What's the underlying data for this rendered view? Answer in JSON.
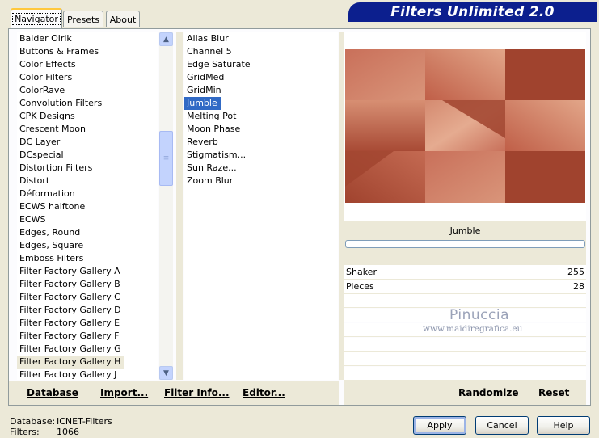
{
  "tabs": [
    {
      "label": "Navigator"
    },
    {
      "label": "Presets"
    },
    {
      "label": "About"
    }
  ],
  "banner": {
    "title": "Filters Unlimited 2.0"
  },
  "categories": [
    "Balder Olrik",
    "Buttons & Frames",
    "Color Effects",
    "Color Filters",
    "ColorRave",
    "Convolution Filters",
    "CPK Designs",
    "Crescent Moon",
    "DC Layer",
    "DCspecial",
    "Distortion Filters",
    "Distort",
    "Déformation",
    "ECWS halftone",
    "ECWS",
    "Edges, Round",
    "Edges, Square",
    "Emboss Filters",
    "Filter Factory Gallery A",
    "Filter Factory Gallery B",
    "Filter Factory Gallery C",
    "Filter Factory Gallery D",
    "Filter Factory Gallery E",
    "Filter Factory Gallery F",
    "Filter Factory Gallery G",
    "Filter Factory Gallery H",
    "Filter Factory Gallery J"
  ],
  "selected_category": "Filter Factory Gallery H",
  "filters": [
    "Alias Blur",
    "Channel 5",
    "Edge Saturate",
    "GridMed",
    "GridMin",
    "Jumble",
    "Melting Pot",
    "Moon Phase",
    "Reverb",
    "Stigmatism...",
    "Sun Raze...",
    "Zoom Blur"
  ],
  "selected_filter": "Jumble",
  "left_buttons": {
    "database": "Database",
    "import": "Import...",
    "filter_info": "Filter Info...",
    "editor": "Editor..."
  },
  "filter_panel": {
    "title": "Jumble",
    "params": [
      {
        "label": "Shaker",
        "value": "255"
      },
      {
        "label": "Pieces",
        "value": "28"
      }
    ],
    "randomize": "Randomize",
    "reset": "Reset"
  },
  "watermark": {
    "line1": "Pinuccia",
    "line2": "www.maidiregrafica.eu"
  },
  "status": {
    "database_label": "Database:",
    "database_value": "ICNET-Filters",
    "filters_label": "Filters:",
    "filters_value": "1066"
  },
  "dialog_buttons": {
    "apply": "Apply",
    "cancel": "Cancel",
    "help": "Help"
  },
  "colors": {
    "banner_bg": "#0c1f8e",
    "selection_blue": "#316ac5",
    "preview_dark": "#a0432e",
    "preview_light": "#d08468"
  }
}
